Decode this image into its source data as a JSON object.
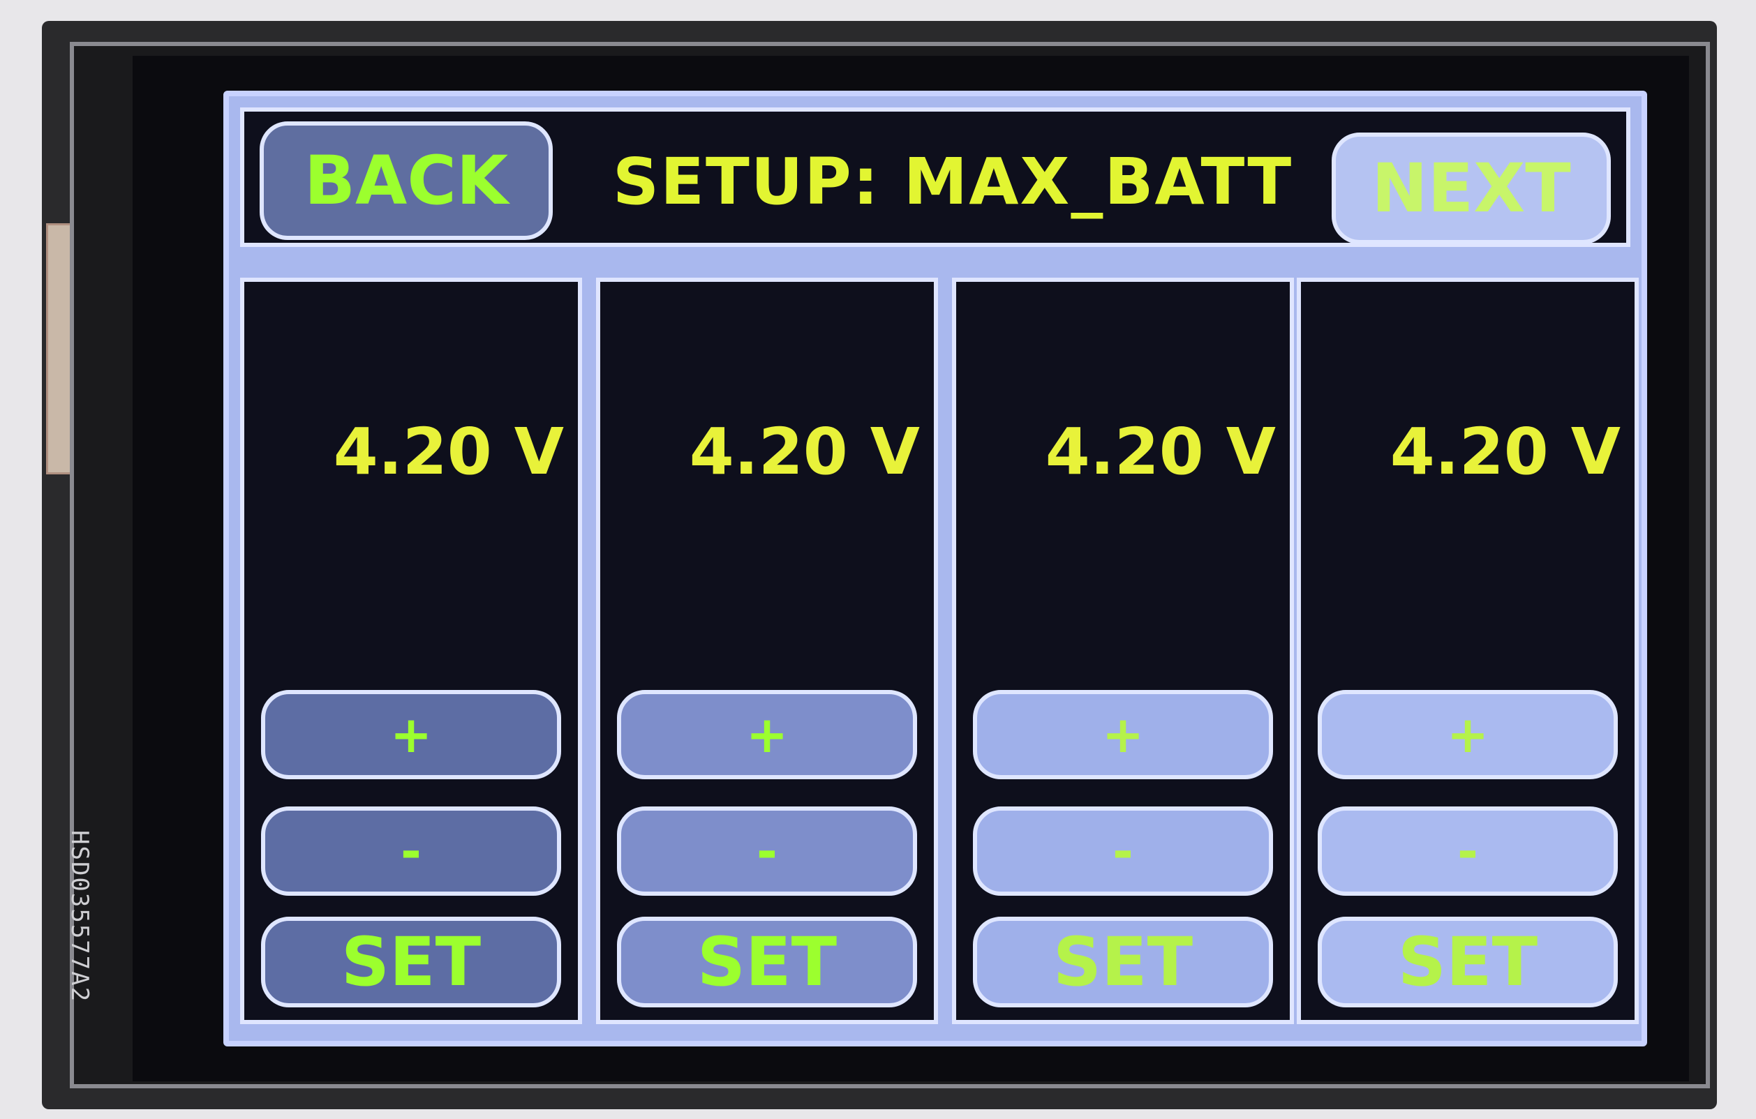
{
  "device": {
    "model_label": "HSD035577A2"
  },
  "header": {
    "back_label": "BACK",
    "title": "SETUP: MAX_BATT",
    "next_label": "NEXT"
  },
  "columns": [
    {
      "value": "4.20 V",
      "plus_label": "+",
      "minus_label": "-",
      "set_label": "SET"
    },
    {
      "value": "4.20 V",
      "plus_label": "+",
      "minus_label": "-",
      "set_label": "SET"
    },
    {
      "value": "4.20 V",
      "plus_label": "+",
      "minus_label": "-",
      "set_label": "SET"
    },
    {
      "value": "4.20 V",
      "plus_label": "+",
      "minus_label": "-",
      "set_label": "SET"
    }
  ],
  "colors": {
    "button_text": "#9cff2e",
    "value_text": "#e8f23a",
    "panel_bg": "#0e0f1c",
    "frame": "#a9b8ee"
  }
}
